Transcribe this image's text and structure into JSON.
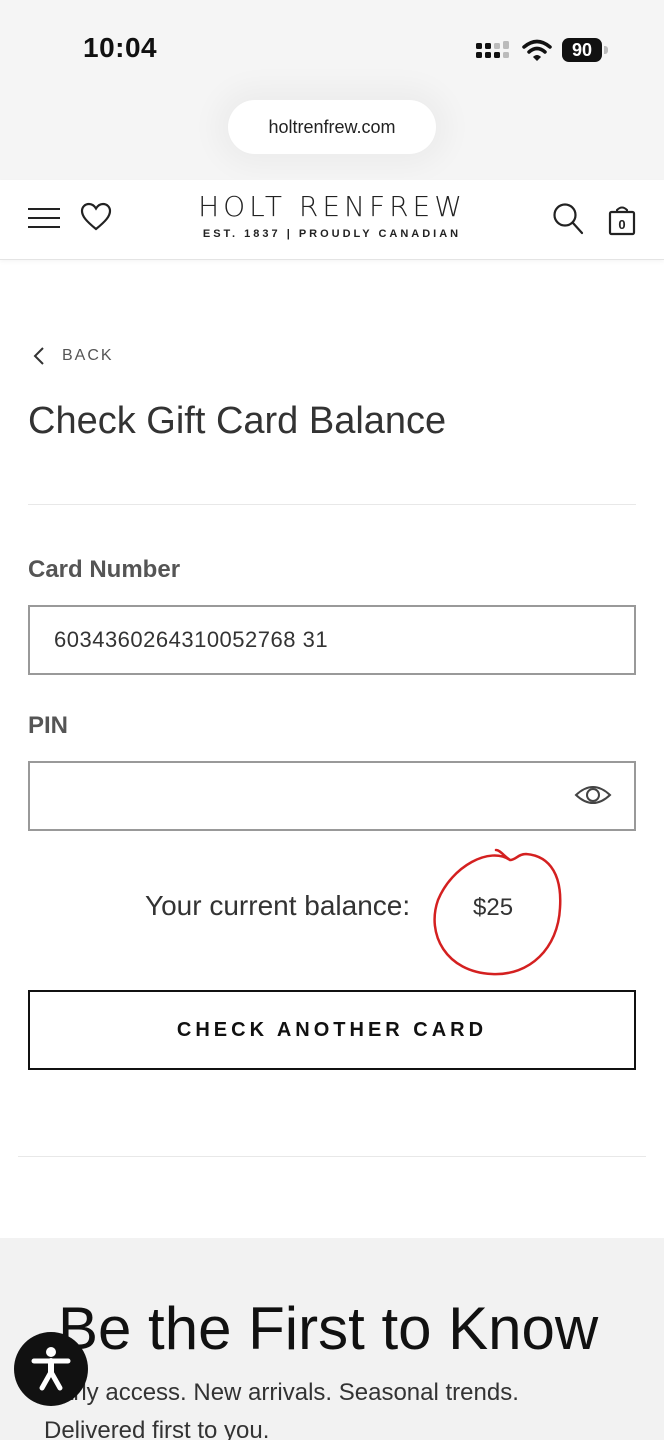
{
  "status_bar": {
    "time": "10:04",
    "battery": "90"
  },
  "browser": {
    "url": "holtrenfrew.com"
  },
  "header": {
    "logo_main": "HOLT RENFREW",
    "logo_sub": "EST. 1837 | PROUDLY CANADIAN",
    "cart_count": "0"
  },
  "main": {
    "back_label": "BACK",
    "title": "Check Gift Card Balance",
    "card_number": {
      "label": "Card Number",
      "value": "6034360264310052768 31"
    },
    "pin": {
      "label": "PIN",
      "value": ""
    },
    "balance_label": "Your current balance:",
    "balance_value": "$25",
    "check_another_label": "CHECK ANOTHER CARD"
  },
  "newsletter": {
    "title": "Be the First to Know",
    "text": "Early access. New arrivals. Seasonal trends. Delivered first to you."
  },
  "colors": {
    "annotation_red": "#d42020",
    "text_dark": "#222222"
  },
  "icons": [
    "hamburger-menu-icon",
    "heart-icon",
    "search-icon",
    "shopping-bag-icon",
    "chevron-left-icon",
    "eye-icon",
    "accessibility-icon"
  ]
}
